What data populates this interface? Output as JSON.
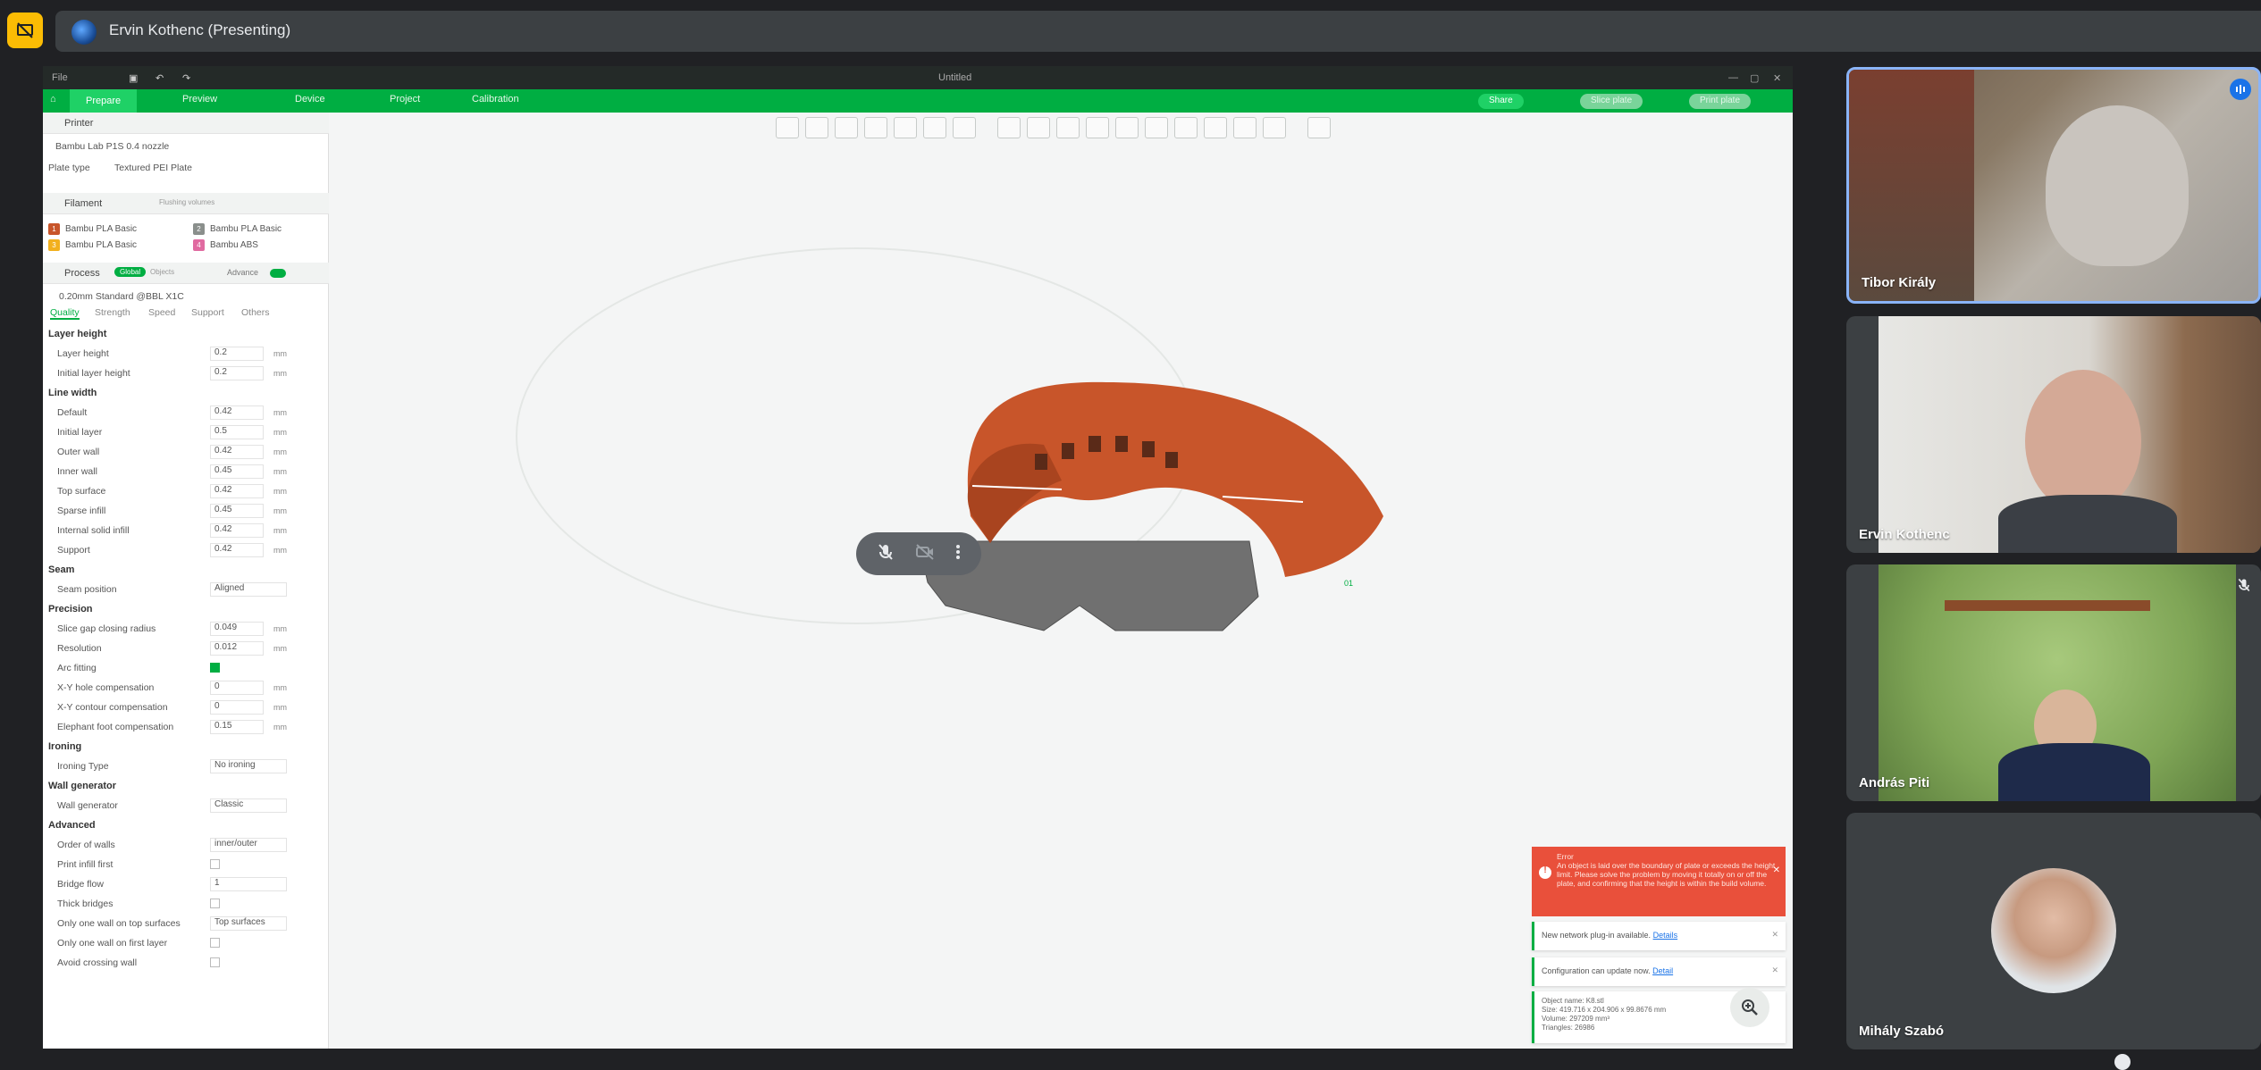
{
  "meeting": {
    "presenter_label": "Ervin Kothenc (Presenting)"
  },
  "app": {
    "title": "Untitled",
    "menu_file": "File",
    "tabs": [
      "Prepare",
      "Preview",
      "Device",
      "Project",
      "Calibration"
    ],
    "share_label": "Share",
    "slice_label": "Slice plate",
    "print_label": "Print plate"
  },
  "printer": {
    "section": "Printer",
    "name": "Bambu Lab P1S 0.4 nozzle",
    "plate_type_label": "Plate type",
    "plate_type_value": "Textured PEI Plate"
  },
  "filament": {
    "section": "Filament",
    "flushing": "Flushing volumes",
    "items": [
      {
        "num": "1",
        "name": "Bambu PLA Basic",
        "color": "#c8552a"
      },
      {
        "num": "2",
        "name": "Bambu PLA Basic",
        "color": "#8a8f8c"
      },
      {
        "num": "3",
        "name": "Bambu PLA Basic",
        "color": "#f2b01e"
      },
      {
        "num": "4",
        "name": "Bambu ABS",
        "color": "#e06aa0"
      }
    ]
  },
  "process": {
    "section": "Process",
    "global": "Global",
    "objects": "Objects",
    "advance": "Advance",
    "preset": "0.20mm Standard @BBL X1C",
    "tabs": [
      "Quality",
      "Strength",
      "Speed",
      "Support",
      "Others"
    ]
  },
  "settings": {
    "layer_height_h": "Layer height",
    "layer_height": {
      "label": "Layer height",
      "value": "0.2",
      "unit": "mm"
    },
    "initial_layer_height": {
      "label": "Initial layer height",
      "value": "0.2",
      "unit": "mm"
    },
    "line_width_h": "Line width",
    "line_width": [
      {
        "label": "Default",
        "value": "0.42",
        "unit": "mm"
      },
      {
        "label": "Initial layer",
        "value": "0.5",
        "unit": "mm"
      },
      {
        "label": "Outer wall",
        "value": "0.42",
        "unit": "mm"
      },
      {
        "label": "Inner wall",
        "value": "0.45",
        "unit": "mm"
      },
      {
        "label": "Top surface",
        "value": "0.42",
        "unit": "mm"
      },
      {
        "label": "Sparse infill",
        "value": "0.45",
        "unit": "mm"
      },
      {
        "label": "Internal solid infill",
        "value": "0.42",
        "unit": "mm"
      },
      {
        "label": "Support",
        "value": "0.42",
        "unit": "mm"
      }
    ],
    "seam_h": "Seam",
    "seam_position": {
      "label": "Seam position",
      "value": "Aligned"
    },
    "precision_h": "Precision",
    "slice_gap": {
      "label": "Slice gap closing radius",
      "value": "0.049",
      "unit": "mm"
    },
    "resolution": {
      "label": "Resolution",
      "value": "0.012",
      "unit": "mm"
    },
    "arc_fitting": {
      "label": "Arc fitting"
    },
    "xy_hole": {
      "label": "X-Y hole compensation",
      "value": "0",
      "unit": "mm"
    },
    "xy_contour": {
      "label": "X-Y contour compensation",
      "value": "0",
      "unit": "mm"
    },
    "elephant": {
      "label": "Elephant foot compensation",
      "value": "0.15",
      "unit": "mm"
    },
    "ironing_h": "Ironing",
    "ironing_type": {
      "label": "Ironing Type",
      "value": "No ironing"
    },
    "wall_gen_h": "Wall generator",
    "wall_generator": {
      "label": "Wall generator",
      "value": "Classic"
    },
    "advanced_h": "Advanced",
    "order_walls": {
      "label": "Order of walls",
      "value": "inner/outer"
    },
    "print_infill_first": {
      "label": "Print infill first"
    },
    "bridge_flow": {
      "label": "Bridge flow",
      "value": "1"
    },
    "thick_bridges": {
      "label": "Thick bridges"
    },
    "one_wall_top": {
      "label": "Only one wall on top surfaces",
      "value": "Top surfaces"
    },
    "one_wall_first": {
      "label": "Only one wall on first layer"
    },
    "avoid_crossing": {
      "label": "Avoid crossing wall"
    }
  },
  "notifications": {
    "error_title": "Error",
    "error_text": "An object is laid over the boundary of plate or exceeds the height limit. Please solve the problem by moving it totally on or off the plate, and confirming that the height is within the build volume.",
    "plugin_text": "New network plug-in available.",
    "plugin_link": "Details",
    "config_text": "Configuration can update now.",
    "config_link": "Detail",
    "info_lines": [
      "Object name: K8.stl",
      "Size: 419.716 x 204.906 x 99.8676 mm",
      "Volume: 297209 mm³",
      "Triangles: 26986"
    ]
  },
  "participants": [
    {
      "name": "Tibor Király",
      "active": true
    },
    {
      "name": "Ervin Kothenc",
      "active": false
    },
    {
      "name": "András Piti",
      "active": false
    },
    {
      "name": "Mihály Szabó",
      "active": false
    }
  ],
  "colors": {
    "bambu_green": "#00ae42",
    "model_orange": "#c8552a",
    "meet_bg": "#202124",
    "tile_bg": "#3c4043",
    "active_border": "#8ab4f8",
    "error_red": "#e9503b"
  },
  "icons": [
    "present-off-icon",
    "mic-off-icon",
    "camera-off-icon",
    "more-vert-icon",
    "zoom-icon",
    "close-icon",
    "audio-levels-icon"
  ]
}
